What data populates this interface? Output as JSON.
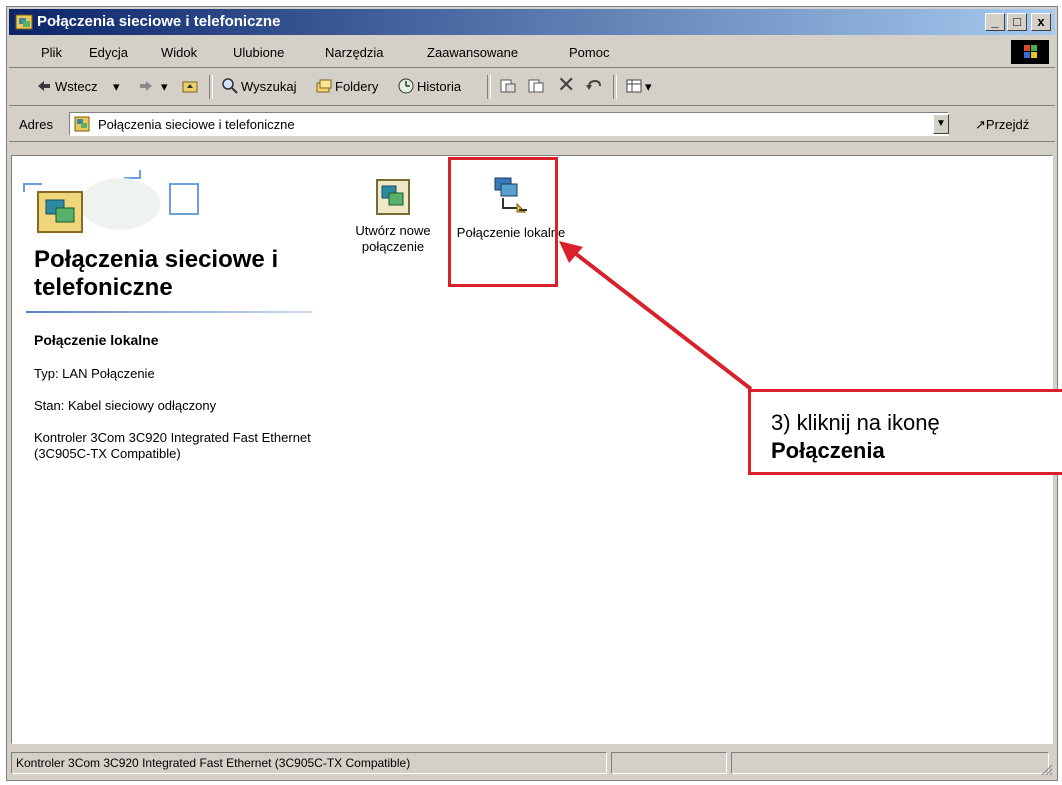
{
  "window": {
    "title": "Połączenia sieciowe i telefoniczne",
    "controls": {
      "minimize": "_",
      "maximize": "□",
      "close": "x"
    }
  },
  "menu": [
    "Plik",
    "Edycja",
    "Widok",
    "Ulubione",
    "Narzędzia",
    "Zaawansowane",
    "Pomoc"
  ],
  "toolbar": {
    "back": "Wstecz",
    "search": "Wyszukaj",
    "folders": "Foldery",
    "history": "Historia"
  },
  "address": {
    "label": "Adres",
    "value": "Połączenia sieciowe i telefoniczne",
    "go": "Przejdź"
  },
  "panel": {
    "title": "Połączenia sieciowe i telefoniczne",
    "details": {
      "name": "Połączenie lokalne",
      "type": "Typ: LAN Połączenie",
      "status": "Stan: Kabel sieciowy odłączony",
      "device": "Kontroler 3Com 3C920 Integrated Fast Ethernet (3C905C-TX Compatible)"
    }
  },
  "icons": [
    {
      "label": "Utwórz nowe połączenie"
    },
    {
      "label": "Połączenie lokalne"
    }
  ],
  "callout": {
    "line1": "3) kliknij na ikonę",
    "line2": "Połączenia"
  },
  "status": {
    "text": "Kontroler 3Com 3C920 Integrated Fast Ethernet (3C905C-TX Compatible)"
  },
  "colors": {
    "accent": "#d8212b",
    "titlebar": "#0a246a"
  }
}
